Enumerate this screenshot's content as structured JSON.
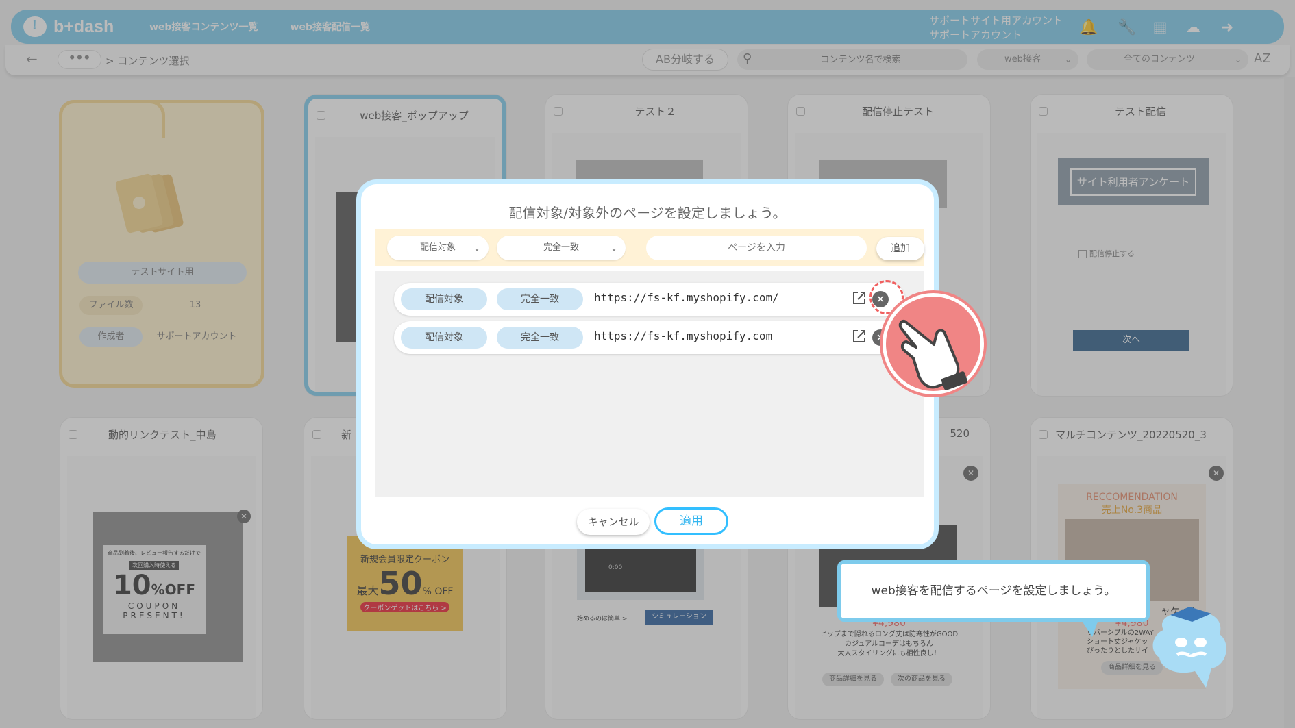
{
  "header": {
    "logo": "b+dash",
    "nav": [
      "web接客コンテンツ一覧",
      "web接客配信一覧"
    ],
    "account_line1": "サポートサイト用アカウント",
    "account_line2": "サポートアカウント",
    "icons": [
      "bell-icon",
      "wrench-icon",
      "grid-icon",
      "chat-icon",
      "logout-icon"
    ]
  },
  "subbar": {
    "back": "←",
    "more": "•••",
    "breadcrumb": "> コンテンツ選択",
    "ab_button": "AB分岐する",
    "search_placeholder": "コンテンツ名で検索",
    "filter1": "web接客",
    "filter2": "全てのコンテンツ",
    "sort": "AZ"
  },
  "folder": {
    "name": "テストサイト用",
    "files_label": "ファイル数",
    "files_count": "13",
    "creator_label": "作成者",
    "creator": "サポートアカウント"
  },
  "cards": [
    {
      "title": "web接客_ポップアップ"
    },
    {
      "title": "テスト２"
    },
    {
      "title": "配信停止テスト"
    },
    {
      "title": "テスト配信"
    },
    {
      "title": "動的リンクテスト_中島"
    },
    {
      "title": "新"
    },
    {
      "title": ""
    },
    {
      "title": "520"
    },
    {
      "title": "マルチコンテンツ_20220520_3"
    }
  ],
  "card_texts": {
    "survey_button": "サイト利用者アンケート",
    "stop_check": "配信停止する",
    "next_button": "次へ",
    "coupon_top": "商品到着後、レビュー報告するだけで",
    "coupon_sub": "次回購入時使える",
    "coupon_value": "10",
    "coupon_off": "%OFF",
    "coupon_present": "COUPON PRESENT!",
    "member_coupon": "新規会員限定クーポン",
    "member_max": "最大",
    "member_value": "50",
    "member_off": "% OFF",
    "member_button": "クーポンゲットはこちら >",
    "video_time": "0:00",
    "video_start": "始めるのは簡単 >",
    "simulation": "シミュレーション",
    "price": "¥4,980",
    "desc1": "ヒップまで隠れるロング丈は防寒性がGOOD",
    "desc2": "カジュアルコーデはもちろん",
    "desc3": "大人スタイリングにも相性良し！",
    "detail_button": "商品詳細を見る",
    "next_product": "次の商品を見る",
    "recommend": "RECCOMENDATION",
    "rank": "売上No.3商品",
    "jacket": "ャケット",
    "rev1": "リバーシブルの2WAY",
    "rev2": "ショート丈ジャケッ",
    "rev3": "ぴったりとしたサイ"
  },
  "modal": {
    "title": "配信対象/対象外のページを設定しましょう。",
    "select_target": "配信対象",
    "select_match": "完全一致",
    "input_placeholder": "ページを入力",
    "add_button": "追加",
    "rows": [
      {
        "target": "配信対象",
        "match": "完全一致",
        "url": "https://fs-kf.myshopify.com/"
      },
      {
        "target": "配信対象",
        "match": "完全一致",
        "url": "https://fs-kf.myshopify.com"
      }
    ],
    "cancel": "キャンセル",
    "apply": "適用"
  },
  "tooltip": "web接客を配信するページを設定しましょう。",
  "colors": {
    "brand": "#7ecbec",
    "folder": "#f5d68e",
    "apply_border": "#33bfff",
    "pointer": "#f08585"
  }
}
